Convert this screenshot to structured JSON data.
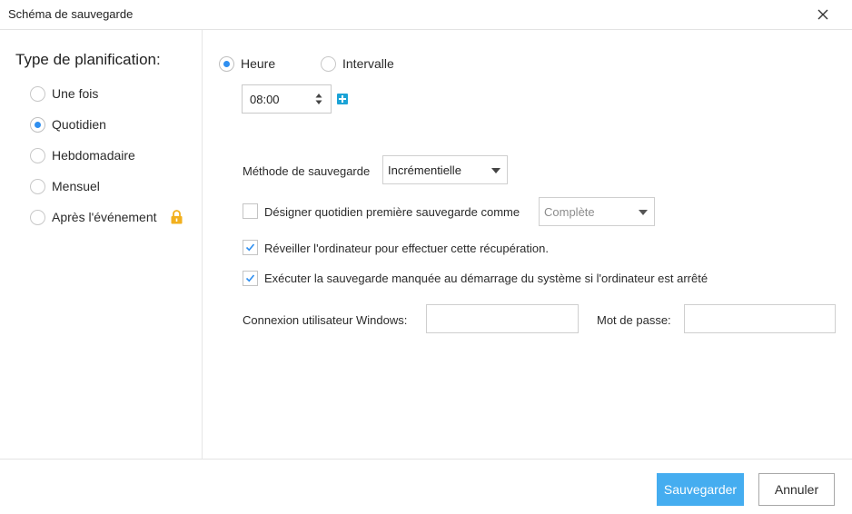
{
  "window": {
    "title": "Schéma de sauvegarde"
  },
  "sidebar": {
    "heading": "Type de planification:",
    "options": [
      {
        "label": "Une fois",
        "checked": false
      },
      {
        "label": "Quotidien",
        "checked": true
      },
      {
        "label": "Hebdomadaire",
        "checked": false
      },
      {
        "label": "Mensuel",
        "checked": false
      },
      {
        "label": "Après l'événement",
        "checked": false,
        "locked": true
      }
    ]
  },
  "schedule": {
    "mode_heure": "Heure",
    "mode_intervalle": "Intervalle",
    "selected_mode": "Heure",
    "time_value": "08:00"
  },
  "backup_method": {
    "label": "Méthode de sauvegarde",
    "value": "Incrémentielle"
  },
  "first_backup": {
    "label": "Désigner quotidien première sauvegarde comme",
    "checked": false,
    "value": "Complète"
  },
  "wake_computer": {
    "label": "Réveiller l'ordinateur pour effectuer cette récupération.",
    "checked": true
  },
  "missed_backup": {
    "label": "Exécuter la sauvegarde manquée au démarrage du système si l'ordinateur est arrêté",
    "checked": true
  },
  "credentials": {
    "user_label": "Connexion utilisateur Windows:",
    "user_value": "",
    "password_label": "Mot de passe:",
    "password_value": ""
  },
  "footer": {
    "save_label": "Sauvegarder",
    "cancel_label": "Annuler"
  },
  "colors": {
    "accent": "#2f8ff0",
    "primary_button": "#45adf0",
    "plus_icon": "#1ba3d6",
    "lock_icon": "#f2b01e"
  }
}
